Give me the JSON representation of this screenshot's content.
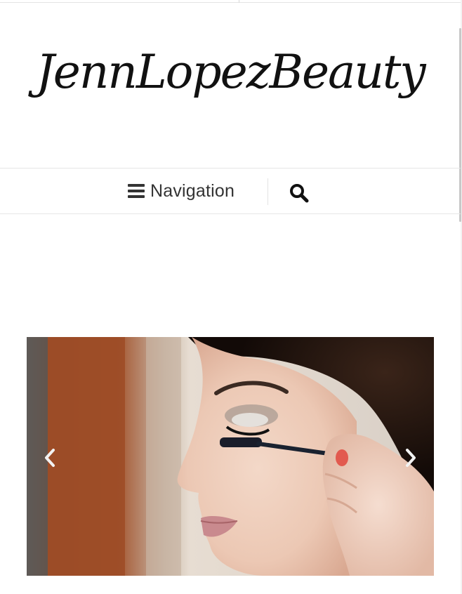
{
  "header": {
    "site_title": "JennLopezBeauty"
  },
  "nav": {
    "label": "Navigation",
    "icons": {
      "menu": "hamburger-icon",
      "search": "search-icon"
    }
  },
  "slider": {
    "icons": {
      "prev": "chevron-left-icon",
      "next": "chevron-right-icon"
    },
    "current_slide_image": "woman applying mascara"
  },
  "colors": {
    "text": "#333333",
    "title": "#111111",
    "border": "#e6e6e6",
    "background": "#ffffff"
  }
}
